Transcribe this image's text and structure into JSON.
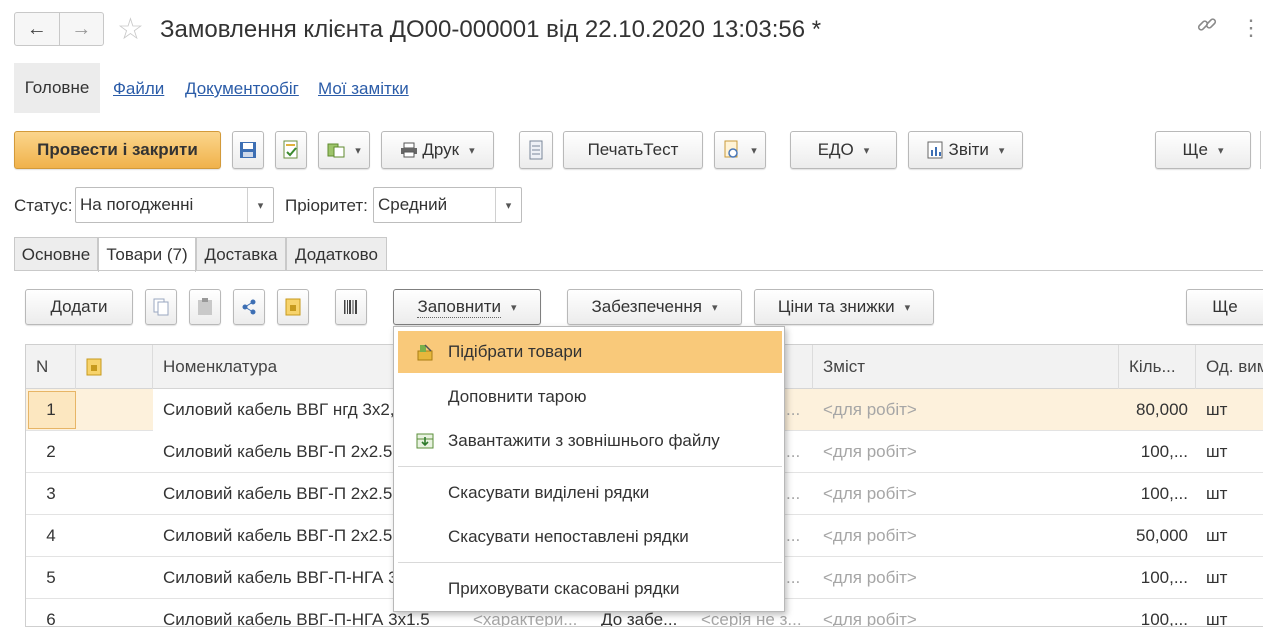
{
  "header": {
    "title": "Замовлення клієнта ДО00-000001 від 22.10.2020 13:03:56 *",
    "back_icon": "←",
    "forward_icon": "→",
    "star_icon": "☆",
    "link_icon": "🔗",
    "more_icon": "⋮"
  },
  "nav": {
    "main": "Головне",
    "links": [
      "Файли",
      "Документообіг",
      "Мої замітки"
    ]
  },
  "toolbar": {
    "post_close": "Провести і закрити",
    "print": "Друк",
    "print_test": "ПечатьТест",
    "edo": "ЕДО",
    "reports": "Звіти",
    "more": "Ще"
  },
  "status": {
    "status_label": "Статус:",
    "status_value": "На погодженні",
    "priority_label": "Пріоритет:",
    "priority_value": "Средний"
  },
  "tabs": [
    "Основне",
    "Товари (7)",
    "Доставка",
    "Додатково"
  ],
  "table_toolbar": {
    "add": "Додати",
    "fill": "Заповнити",
    "provision": "Забезпечення",
    "prices": "Ціни та знижки",
    "more": "Ще"
  },
  "table": {
    "headers": {
      "n": "N",
      "nomenclature": "Номенклатура",
      "content": "Зміст",
      "qty": "Кіль...",
      "unit": "Од. вим"
    },
    "rows": [
      {
        "n": "1",
        "name": "Силовий кабель ВВГ нгд 3х2,5",
        "mid": "...",
        "content": "<для робіт>",
        "qty": "80,000",
        "unit": "шт"
      },
      {
        "n": "2",
        "name": "Силовий кабель ВВГ-П 2х2.5",
        "mid": "...",
        "content": "<для робіт>",
        "qty": "100,...",
        "unit": "шт"
      },
      {
        "n": "3",
        "name": "Силовий кабель ВВГ-П 2х2.5",
        "mid": "...",
        "content": "<для робіт>",
        "qty": "100,...",
        "unit": "шт"
      },
      {
        "n": "4",
        "name": "Силовий кабель ВВГ-П 2х2.5",
        "mid": "...",
        "content": "<для робіт>",
        "qty": "50,000",
        "unit": "шт"
      },
      {
        "n": "5",
        "name": "Силовий кабель ВВГ-П-НГА 3х",
        "mid": "...",
        "content": "<для робіт>",
        "qty": "100,...",
        "unit": "шт"
      },
      {
        "n": "6",
        "name": "Силовий кабель ВВГ-П-НГА 3х1.5",
        "char": "<характери...",
        "prov": "До забе...",
        "series": "<серія не з...",
        "content": "<для робіт>",
        "qty": "100,...",
        "unit": "шт"
      }
    ]
  },
  "menu": {
    "items": [
      "Підібрати товари",
      "Доповнити тарою",
      "Завантажити з зовнішнього файлу",
      "Скасувати виділені рядки",
      "Скасувати непоставлені рядки",
      "Приховувати скасовані рядки"
    ]
  },
  "colors": {
    "primary_button": "#f0b24b",
    "menu_highlight": "#f9c97a",
    "selected_row": "#fdf1dc",
    "link": "#2b5ca8"
  }
}
